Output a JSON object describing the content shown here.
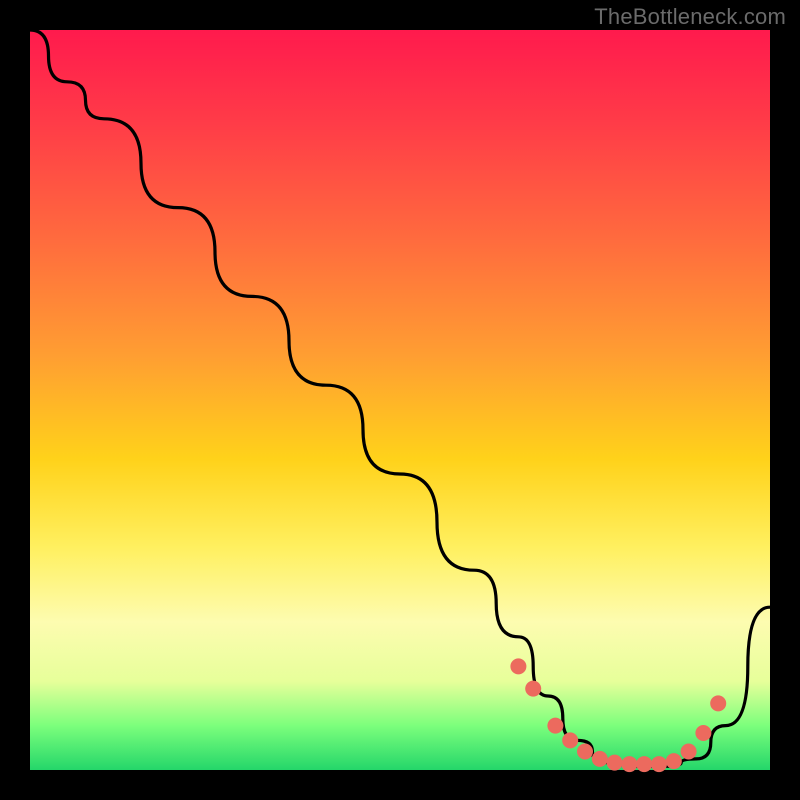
{
  "watermark": "TheBottleneck.com",
  "chart_data": {
    "type": "line",
    "title": "",
    "xlabel": "",
    "ylabel": "",
    "xlim": [
      0,
      100
    ],
    "ylim": [
      0,
      100
    ],
    "grid": false,
    "legend": false,
    "series": [
      {
        "name": "bottleneck-curve",
        "color": "#000000",
        "x": [
          0,
          5,
          10,
          20,
          30,
          40,
          50,
          60,
          66,
          70,
          74,
          78,
          82,
          86,
          90,
          94,
          100
        ],
        "y": [
          100,
          93,
          88,
          76,
          64,
          52,
          40,
          27,
          18,
          10,
          4,
          1,
          0.5,
          0.5,
          1.5,
          6,
          22
        ]
      }
    ],
    "markers": {
      "name": "flat-region-dots",
      "shape": "circle",
      "color": "#ec6a5e",
      "radius_px": 8,
      "x": [
        66,
        68,
        71,
        73,
        75,
        77,
        79,
        81,
        83,
        85,
        87,
        89,
        91,
        93
      ],
      "y": [
        14,
        11,
        6,
        4,
        2.5,
        1.5,
        1,
        0.8,
        0.8,
        0.8,
        1.2,
        2.5,
        5,
        9
      ]
    },
    "background_gradient": {
      "direction": "vertical",
      "stops": [
        {
          "pos": 0.0,
          "color": "#ff1a4d"
        },
        {
          "pos": 0.28,
          "color": "#ff6a3e"
        },
        {
          "pos": 0.58,
          "color": "#ffd21a"
        },
        {
          "pos": 0.8,
          "color": "#fdfcb0"
        },
        {
          "pos": 0.94,
          "color": "#7cff7c"
        },
        {
          "pos": 1.0,
          "color": "#24d66a"
        }
      ]
    }
  }
}
